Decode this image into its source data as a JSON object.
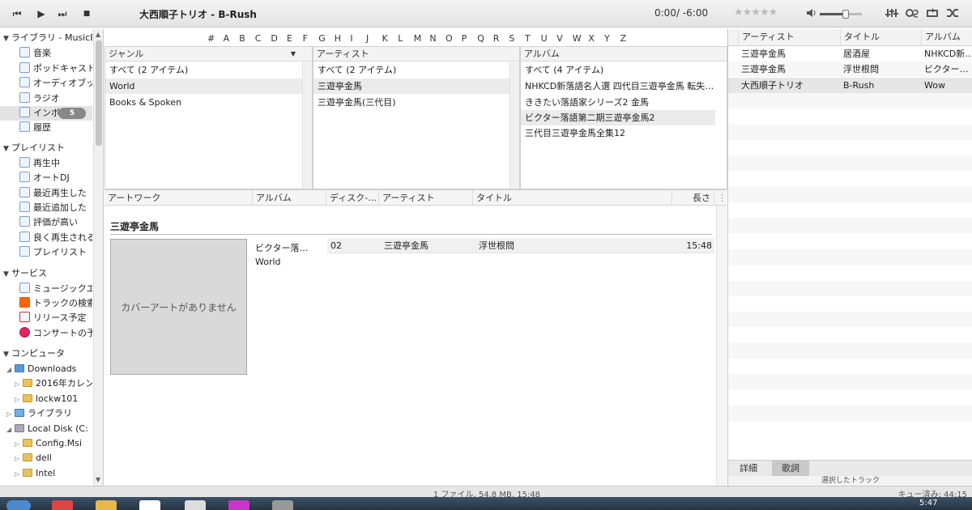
{
  "colors": {
    "accent": "#555555",
    "selected_row": "#e6e6e6",
    "cover_bg": "#d9d9d9"
  },
  "toolbar": {
    "prev_icon": "skip-back-icon",
    "prev": "⏮",
    "play_icon": "play-icon",
    "play": "▶",
    "next_icon": "skip-forward-icon",
    "next": "⏭",
    "stop_icon": "stop-icon",
    "stop": "■",
    "now_playing": "大西順子トリオ - B-Rush",
    "time": "0:00/ -6:00",
    "rating_stars": "★★★★★",
    "rating_value": 0,
    "volume_level": 0.6
  },
  "sidebar": {
    "library_header": "ライブラリ - MusicB",
    "library_items": [
      {
        "label": "音楽",
        "icon": "music-note-icon"
      },
      {
        "label": "ポッドキャスト",
        "icon": "microphone-icon"
      },
      {
        "label": "オーディオブック",
        "icon": "audiobook-icon"
      },
      {
        "label": "ラジオ",
        "icon": "radio-icon"
      },
      {
        "label": "インボックス",
        "icon": "inbox-icon",
        "badge": "5"
      },
      {
        "label": "履歴",
        "icon": "clock-icon"
      }
    ],
    "playlist_header": "プレイリスト",
    "playlist_items": [
      {
        "label": "再生中",
        "icon": "playlist-icon"
      },
      {
        "label": "オートDJ",
        "icon": "playlist-icon"
      },
      {
        "label": "最近再生した",
        "icon": "smart-playlist-icon"
      },
      {
        "label": "最近追加した",
        "icon": "smart-playlist-icon"
      },
      {
        "label": "評価が高い",
        "icon": "smart-playlist-icon"
      },
      {
        "label": "良く再生される",
        "icon": "smart-playlist-icon"
      },
      {
        "label": "プレイリスト",
        "icon": "playlist-icon"
      }
    ],
    "services_header": "サービス",
    "service_items": [
      {
        "label": "ミュージックエ",
        "icon": "people-icon"
      },
      {
        "label": "トラックの検索",
        "icon": "soundcloud-icon"
      },
      {
        "label": "リリース予定",
        "icon": "calendar-icon"
      },
      {
        "label": "コンサートの予",
        "icon": "songkick-icon"
      }
    ],
    "computer_header": "コンピュータ",
    "computer_items": [
      {
        "label": "Downloads",
        "level": 1,
        "expanded": true
      },
      {
        "label": "2016年カレン",
        "level": 2
      },
      {
        "label": "lockw101",
        "level": 2
      },
      {
        "label": "ライブラリ",
        "level": 1
      },
      {
        "label": "Local Disk (C:",
        "level": 1,
        "expanded": true
      },
      {
        "label": "Config.Msi",
        "level": 2
      },
      {
        "label": "dell",
        "level": 2
      },
      {
        "label": "Intel",
        "level": 2
      }
    ]
  },
  "alphabet": [
    "#",
    "A",
    "B",
    "C",
    "D",
    "E",
    "F",
    "G",
    "H",
    "I",
    "J",
    "K",
    "L",
    "M",
    "N",
    "O",
    "P",
    "Q",
    "R",
    "S",
    "T",
    "U",
    "V",
    "W",
    "X",
    "Y",
    "Z"
  ],
  "browser": {
    "genre": {
      "header": "ジャンル",
      "rows": [
        "すべて (2 アイテム)",
        "World",
        "Books & Spoken"
      ],
      "selected": 1
    },
    "artist": {
      "header": "アーティスト",
      "rows": [
        "すべて (2 アイテム)",
        "三遊亭金馬",
        "三遊亭金馬(三代目)"
      ],
      "selected": 1
    },
    "album": {
      "header": "アルバム",
      "rows": [
        "すべて (4 アイテム)",
        "NHKCD新落語名人選 四代目三遊亭金馬 転失…",
        "ききたい落語家シリーズ2 金馬",
        "ビクター落語第二期三遊亭金馬2",
        "三代目三遊亭金馬全集12"
      ],
      "selected": 3
    }
  },
  "tracklist": {
    "columns": [
      "アートワーク",
      "アルバム",
      "ディスク-…",
      "アーティスト",
      "タイトル",
      "長さ"
    ],
    "group_title": "三遊亭金馬",
    "cover_text": "カバーアートがありません",
    "album_name": "ビクター落…",
    "album_genre": "World",
    "track": {
      "disc": "02",
      "artist": "三遊亭金馬",
      "title": "浮世根問",
      "length": "15:48"
    }
  },
  "queue": {
    "columns": [
      "アーティスト",
      "タイトル",
      "アルバム"
    ],
    "rows": [
      {
        "artist": "三遊亭金馬",
        "title": "居酒屋",
        "album": "NHKCD新…"
      },
      {
        "artist": "三遊亭金馬",
        "title": "浮世根問",
        "album": "ビクター…"
      },
      {
        "artist": "大西順子トリオ",
        "title": "B-Rush",
        "album": "Wow"
      }
    ],
    "tabs": [
      "詳細",
      "歌詞"
    ],
    "sub_text": "選択したトラック"
  },
  "status": {
    "summary": "1 ファイル, 54.8 MB, 15:48",
    "queue_total": "キュー済み: 44:15"
  },
  "taskbar": {
    "clock": "5:47"
  }
}
